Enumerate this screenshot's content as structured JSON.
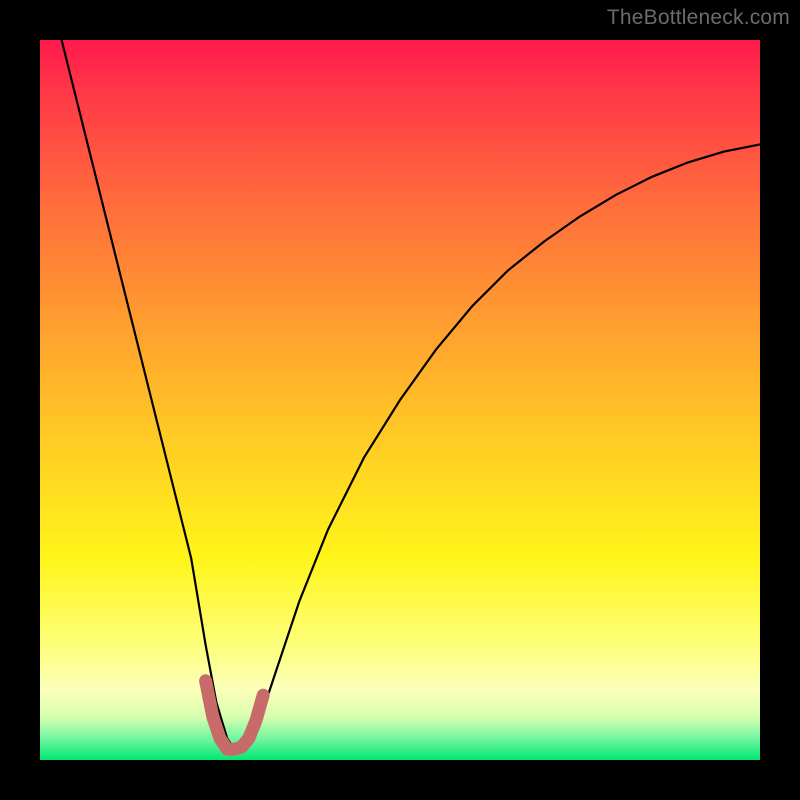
{
  "watermark": "TheBottleneck.com",
  "chart_data": {
    "type": "line",
    "title": "",
    "xlabel": "",
    "ylabel": "",
    "xlim": [
      0,
      100
    ],
    "ylim": [
      0,
      100
    ],
    "series": [
      {
        "name": "bottleneck-curve",
        "x": [
          3,
          6,
          9,
          12,
          15,
          18,
          21,
          23,
          24.5,
          26,
          27,
          28,
          29.5,
          31,
          33,
          36,
          40,
          45,
          50,
          55,
          60,
          65,
          70,
          75,
          80,
          85,
          90,
          95,
          100
        ],
        "values": [
          100,
          88,
          76,
          64,
          52,
          40,
          28,
          16,
          8,
          3,
          1.5,
          1.5,
          3,
          7,
          13,
          22,
          32,
          42,
          50,
          57,
          63,
          68,
          72,
          75.5,
          78.5,
          81,
          83,
          84.5,
          85.5
        ]
      },
      {
        "name": "highlight-region",
        "x": [
          23,
          24,
          25,
          26,
          27,
          28,
          29,
          30,
          31
        ],
        "values": [
          11,
          6,
          3,
          1.5,
          1.5,
          1.8,
          3,
          5.5,
          9
        ]
      }
    ],
    "colors": {
      "curve": "#000000",
      "highlight": "#c96a6a",
      "gradient_top": "#ff1a4d",
      "gradient_mid": "#ffca24",
      "gradient_bottom": "#00e874"
    }
  }
}
